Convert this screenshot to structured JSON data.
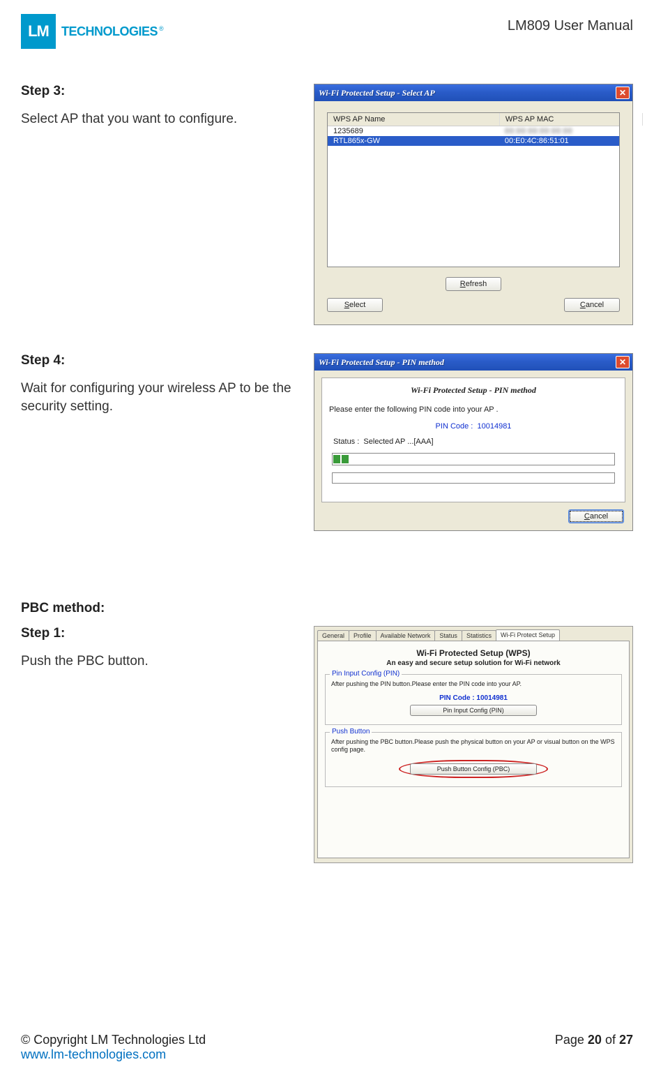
{
  "header": {
    "logo_square": "LM",
    "logo_text": "TECHNOLOGIES",
    "doc_title": "LM809 User Manual"
  },
  "step3": {
    "heading": "Step 3:",
    "body": "Select AP that you want to configure.",
    "dialog": {
      "title": "Wi-Fi Protected Setup - Select AP",
      "col_name": "WPS AP Name",
      "col_mac": "WPS AP MAC",
      "rows": [
        {
          "name": "1235689",
          "mac": "",
          "selected": false
        },
        {
          "name": "RTL865x-GW",
          "mac": "00:E0:4C:86:51:01",
          "selected": true
        }
      ],
      "btn_refresh": "Refresh",
      "btn_select": "Select",
      "btn_cancel": "Cancel"
    }
  },
  "step4": {
    "heading": "Step 4:",
    "body": "Wait for configuring your wireless AP to be the security setting.",
    "dialog": {
      "title": "Wi-Fi Protected Setup - PIN method",
      "subheader": "Wi-Fi Protected Setup - PIN method",
      "instruction": "Please enter the following PIN code into your AP .",
      "pin_label": "PIN Code :",
      "pin_value": "10014981",
      "status_label": "Status :",
      "status_value": "Selected AP ...[AAA]",
      "btn_cancel": "Cancel"
    }
  },
  "pbc": {
    "section": "PBC method:",
    "step_heading": "Step 1:",
    "step_body": "Push the PBC button.",
    "panel": {
      "tabs": [
        "General",
        "Profile",
        "Available Network",
        "Status",
        "Statistics",
        "Wi-Fi Protect Setup"
      ],
      "active_tab": 5,
      "title": "Wi-Fi Protected Setup (WPS)",
      "subtitle": "An easy and secure setup solution for Wi-Fi network",
      "group1": {
        "legend": "Pin Input Config (PIN)",
        "text": "After pushing the PIN button.Please enter the PIN code into your AP.",
        "pin_label": "PIN Code :",
        "pin_value": "10014981",
        "btn": "Pin Input Config (PIN)"
      },
      "group2": {
        "legend": "Push Button",
        "text": "After pushing the PBC button.Please push the physical button on your AP or visual button on the WPS config page.",
        "btn": "Push Button Config (PBC)"
      }
    }
  },
  "footer": {
    "copyright": "© Copyright LM Technologies Ltd",
    "url": "www.lm-technologies.com",
    "page_prefix": "Page ",
    "page_num": "20",
    "page_mid": " of ",
    "page_total": "27"
  }
}
